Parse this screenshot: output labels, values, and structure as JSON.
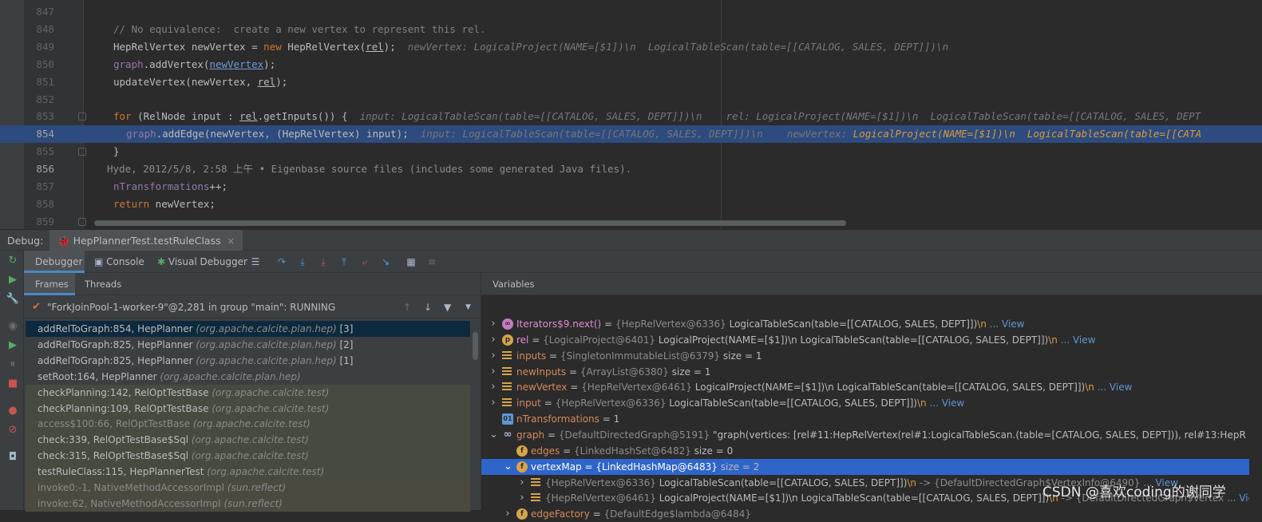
{
  "editor": {
    "lines": [
      {
        "num": "847",
        "code": ""
      },
      {
        "num": "848",
        "code": "// No equivalence:  create a new vertex to represent this rel."
      },
      {
        "num": "849",
        "code_pre_kw": "HepRelVertex newVertex = ",
        "kw": "new",
        "code_post": " HepRelVertex(",
        "arg": "rel",
        "code_end": ");",
        "hint": "newVertex: LogicalProject(NAME=[$1])\\n  LogicalTableScan(table=[[CATALOG, SALES, DEPT]])\\n"
      },
      {
        "num": "850",
        "fld": "graph",
        "code_post": ".addVertex(",
        "link": "newVertex",
        "code_end": ");"
      },
      {
        "num": "851",
        "code": "updateVertex(newVertex, ",
        "arg": "rel",
        "code_end": ");"
      },
      {
        "num": "852",
        "code": ""
      },
      {
        "num": "853",
        "kw": "for",
        "code_post": " (RelNode input : ",
        "arg": "rel",
        "code_end": ".getInputs()) {",
        "hint": "input: LogicalTableScan(table=[[CATALOG, SALES, DEPT]])\\n    rel: LogicalProject(NAME=[$1])\\n  LogicalTableScan(table=[[CATALOG, SALES, DEPT"
      },
      {
        "num": "854",
        "fld": "graph",
        "code_post": ".addEdge(newVertex, (HepRelVertex) input);",
        "hint_a": "input: LogicalTableScan(table=[[CATALOG, SALES, DEPT]])\\n    newVertex: ",
        "hint_b": "LogicalProject(NAME=[$1])\\n  LogicalTableScan(table=[[CATA"
      },
      {
        "num": "855",
        "code": "}"
      },
      {
        "num": "856",
        "blame": "Hyde, 2012/5/8, 2:58 上午 • Eigenbase source files (includes some generated Java files)."
      },
      {
        "num": "857",
        "fld": "nTransformations",
        "code_end": "++;"
      },
      {
        "num": "858",
        "kw": "return",
        "code_end": " newVertex;"
      },
      {
        "num": "859",
        "code": ""
      }
    ]
  },
  "debug": {
    "label": "Debug:",
    "session_tab": "HepPlannerTest.testRuleClass",
    "tabs": [
      "Debugger",
      "Console",
      "Visual Debugger"
    ],
    "subtabs": [
      "Frames",
      "Threads"
    ],
    "thread": "\"ForkJoinPool-1-worker-9\"@2,281 in group \"main\": RUNNING",
    "frames": [
      {
        "method": "addRelToGraph:854, HepPlanner",
        "pkg": "(org.apache.calcite.plan.hep)",
        "suffix": " [3]",
        "style": "sel"
      },
      {
        "method": "addRelToGraph:825, HepPlanner",
        "pkg": "(org.apache.calcite.plan.hep)",
        "suffix": " [2]",
        "style": ""
      },
      {
        "method": "addRelToGraph:825, HepPlanner",
        "pkg": "(org.apache.calcite.plan.hep)",
        "suffix": " [1]",
        "style": ""
      },
      {
        "method": "setRoot:164, HepPlanner",
        "pkg": "(org.apache.calcite.plan.hep)",
        "suffix": "",
        "style": ""
      },
      {
        "method": "checkPlanning:142, RelOptTestBase",
        "pkg": "(org.apache.calcite.test)",
        "suffix": "",
        "style": "lib"
      },
      {
        "method": "checkPlanning:109, RelOptTestBase",
        "pkg": "(org.apache.calcite.test)",
        "suffix": "",
        "style": "lib"
      },
      {
        "method": "access$100:66, RelOptTestBase",
        "pkg": "(org.apache.calcite.test)",
        "suffix": "",
        "style": "lib dim"
      },
      {
        "method": "check:339, RelOptTestBase$Sql",
        "pkg": "(org.apache.calcite.test)",
        "suffix": "",
        "style": "lib"
      },
      {
        "method": "check:315, RelOptTestBase$Sql",
        "pkg": "(org.apache.calcite.test)",
        "suffix": "",
        "style": "lib"
      },
      {
        "method": "testRuleClass:115, HepPlannerTest",
        "pkg": "(org.apache.calcite.test)",
        "suffix": "",
        "style": "lib"
      },
      {
        "method": "invoke0:-1, NativeMethodAccessorImpl",
        "pkg": "(sun.reflect)",
        "suffix": "",
        "style": "lib2 dim"
      },
      {
        "method": "invoke:62, NativeMethodAccessorImpl",
        "pkg": "(sun.reflect)",
        "suffix": "",
        "style": "lib2 dim"
      }
    ],
    "variables_label": "Variables",
    "variables": [
      {
        "icon": "∞",
        "icolor": "#c57dc0",
        "name": "Iterators$9.next()",
        "type": "{HepRelVertex@6336}",
        "value": " LogicalTableScan(table=[[CATALOG, SALES, DEPT]])",
        "nl": "\\n",
        "view": "... View",
        "indent": 0,
        "arrow": "›"
      },
      {
        "icon": "p",
        "icolor": "#d6a54a",
        "name": "rel",
        "type": "{LogicalProject@6401}",
        "value": " LogicalProject(NAME=[$1])\\n  LogicalTableScan(table=[[CATALOG, SALES, DEPT]])",
        "nl": "\\n",
        "view": "... View",
        "indent": 0,
        "arrow": "›"
      },
      {
        "icon": "bars",
        "icolor": "#d6a54a",
        "name": "inputs",
        "type": "{SingletonImmutableList@6379}",
        "value": "  size = 1",
        "nl": "",
        "view": "",
        "indent": 0,
        "arrow": "›"
      },
      {
        "icon": "bars",
        "icolor": "#d6a54a",
        "name": "newInputs",
        "type": "{ArrayList@6380}",
        "value": "  size = 1",
        "nl": "",
        "view": "",
        "indent": 0,
        "arrow": "›"
      },
      {
        "icon": "bars",
        "icolor": "#d6a54a",
        "name": "newVertex",
        "type": "{HepRelVertex@6461}",
        "value": " LogicalProject(NAME=[$1])\\n  LogicalTableScan(table=[[CATALOG, SALES, DEPT]])",
        "nl": "\\n",
        "view": "... View",
        "indent": 0,
        "arrow": "›"
      },
      {
        "icon": "bars",
        "icolor": "#d6a54a",
        "name": "input",
        "type": "{HepRelVertex@6336}",
        "value": " LogicalTableScan(table=[[CATALOG, SALES, DEPT]])",
        "nl": "\\n",
        "view": "... View",
        "indent": 0,
        "arrow": "›"
      },
      {
        "icon": "01",
        "icolor": "#5e97d6",
        "name": "nTransformations",
        "type": "",
        "value": " = 1",
        "nl": "",
        "view": "",
        "indent": 0,
        "arrow": ""
      },
      {
        "icon": "oo",
        "icolor": "#a9b7c6",
        "name": "graph",
        "type": "{DefaultDirectedGraph@5191}",
        "value": " \"graph(vertices: [rel#11:HepRelVertex(rel#1:LogicalTableScan.(table=[CATALOG, SALES, DEPT])), rel#13:HepR",
        "nl": "",
        "view": "... View",
        "indent": 0,
        "arrow": "⌄"
      },
      {
        "icon": "f",
        "icolor": "#d6a54a",
        "name": "edges",
        "type": "{LinkedHashSet@6482}",
        "value": "  size = 0",
        "nl": "",
        "view": "",
        "indent": 1,
        "arrow": ""
      },
      {
        "icon": "f",
        "icolor": "#d6a54a",
        "name": "vertexMap",
        "type": "{LinkedHashMap@6483}",
        "value": "  size = 2",
        "nl": "",
        "view": "",
        "indent": 1,
        "arrow": "⌄",
        "sel": true
      },
      {
        "icon": "bars",
        "icolor": "#d6a54a",
        "name": "",
        "type": "{HepRelVertex@6336}",
        "value": " LogicalTableScan(table=[[CATALOG, SALES, DEPT]])",
        "nl": "\\n",
        "tail": " -> {DefaultDirectedGraph$VertexInfo@6490}",
        "view": "... View",
        "indent": 2,
        "arrow": "›"
      },
      {
        "icon": "bars",
        "icolor": "#d6a54a",
        "name": "",
        "type": "{HepRelVertex@6461}",
        "value": " LogicalProject(NAME=[$1])\\n  LogicalTableScan(table=[[CATALOG, SALES, DEPT]])",
        "nl": "\\n",
        "tail": " -> {DefaultDirectedGraph$Vertex",
        "view": "... View",
        "indent": 2,
        "arrow": "›"
      },
      {
        "icon": "f",
        "icolor": "#d6a54a",
        "name": "edgeFactory",
        "type": "{DefaultEdge$lambda@6484}",
        "value": "",
        "nl": "",
        "view": "",
        "indent": 1,
        "arrow": "›"
      }
    ]
  },
  "watermark": "CSDN @喜欢coding的谢同学"
}
